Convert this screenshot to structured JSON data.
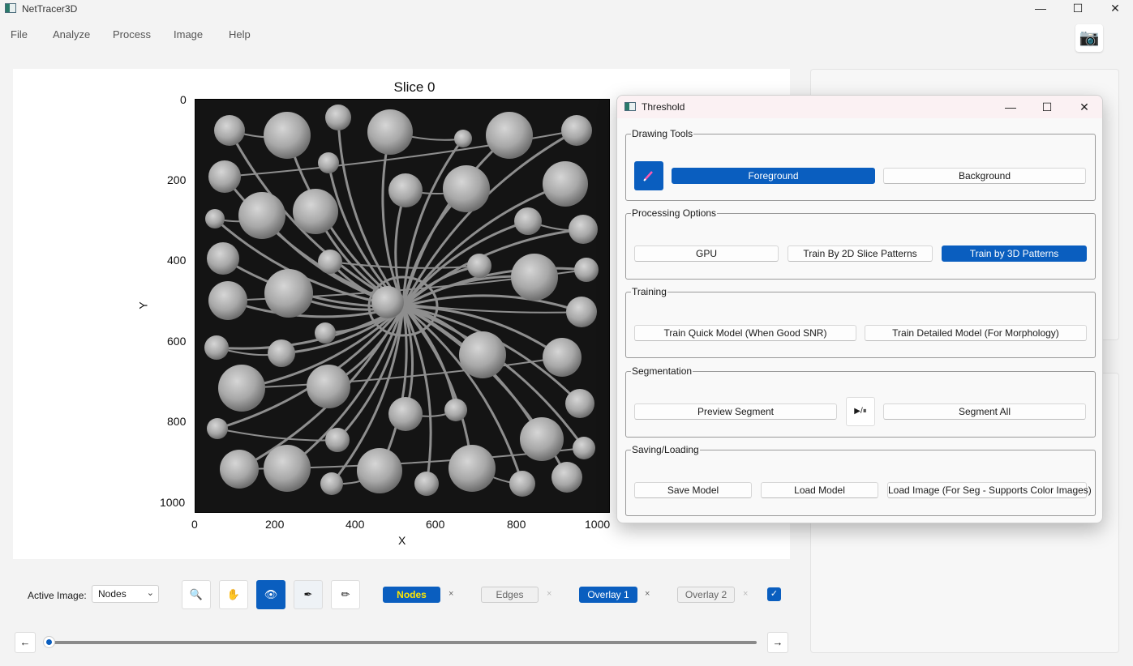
{
  "window": {
    "title": "NetTracer3D",
    "minimize": "—",
    "maximize": "☐",
    "close": "✕"
  },
  "menu": {
    "items": [
      "File",
      "Analyze",
      "Process",
      "Image",
      "Help"
    ]
  },
  "camera_icon": "📷",
  "plot": {
    "title": "Slice 0",
    "xlabel": "X",
    "ylabel": "Y",
    "xticks": [
      "0",
      "200",
      "400",
      "600",
      "800",
      "1000"
    ],
    "yticks": [
      "0",
      "200",
      "400",
      "600",
      "800",
      "1000"
    ]
  },
  "toolbar": {
    "active_image_label": "Active Image:",
    "active_image_value": "Nodes",
    "chev": "⌄",
    "tools": [
      {
        "name": "zoom-tool-button",
        "icon": "🔍"
      },
      {
        "name": "pan-tool-button",
        "icon": "✋"
      },
      {
        "name": "view-tool-button",
        "icon": "👁"
      },
      {
        "name": "brush-tool-button",
        "icon": "✒"
      },
      {
        "name": "highlight-tool-button",
        "icon": "✏"
      }
    ],
    "channels": [
      "Nodes",
      "Edges",
      "Overlay 1",
      "Overlay 2"
    ],
    "close_mark": "×",
    "check_mark": "✓"
  },
  "slider": {
    "prev": "←",
    "next": "→"
  },
  "threshold_dialog": {
    "title": "Threshold",
    "minimize": "—",
    "maximize": "☐",
    "close": "✕",
    "drawing_tools": {
      "legend": "Drawing Tools",
      "foreground": "Foreground",
      "background": "Background"
    },
    "processing_options": {
      "legend": "Processing Options",
      "gpu": "GPU",
      "train_2d": "Train By 2D Slice Patterns",
      "train_3d": "Train by 3D Patterns"
    },
    "training": {
      "legend": "Training",
      "quick": "Train Quick Model (When Good SNR)",
      "detailed": "Train Detailed Model (For Morphology)"
    },
    "segmentation": {
      "legend": "Segmentation",
      "preview": "Preview Segment",
      "play_pause": "▶/⏸",
      "segment_all": "Segment All"
    },
    "saving_loading": {
      "legend": "Saving/Loading",
      "save": "Save Model",
      "load": "Load Model",
      "load_image": "Load Image (For Seg - Supports Color Images)"
    }
  }
}
